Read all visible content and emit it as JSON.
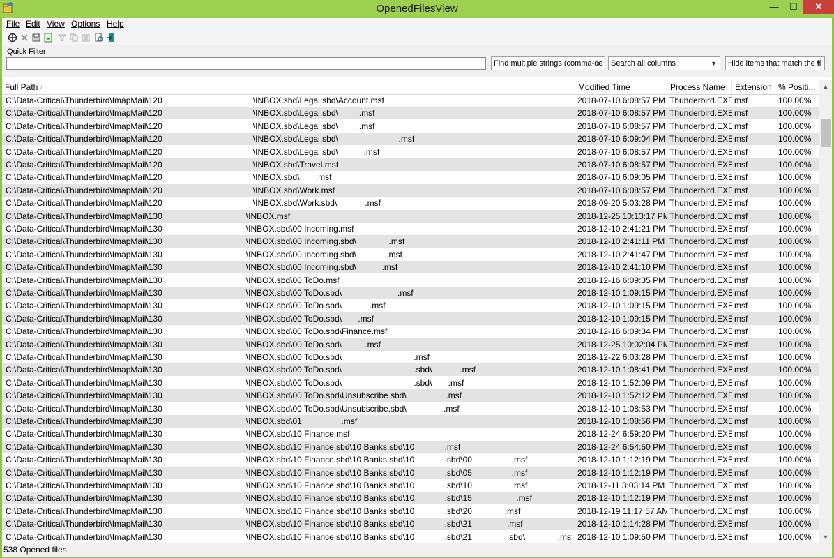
{
  "window": {
    "title": "OpenedFilesView",
    "min": "—",
    "max": "☐",
    "close": "✕"
  },
  "menu": [
    "File",
    "Edit",
    "View",
    "Options",
    "Help"
  ],
  "toolbar": {
    "icons": [
      "open-icon",
      "delete-icon",
      "save-icon",
      "refresh-icon",
      "filter-icon",
      "copy-icon",
      "properties-icon",
      "find-icon",
      "exit-icon"
    ]
  },
  "filter": {
    "label": "Quick Filter",
    "value": "",
    "mode": "Find multiple strings (comma-de",
    "columns": "Search all columns",
    "action": "Hide items that match the fi"
  },
  "columns": [
    "Full Path",
    "Modified Time",
    "Process Name",
    "Extension",
    "% Positi..."
  ],
  "rows": [
    {
      "path": "C:\\Data-Critical\\Thunderbird\\ImapMail\\120                                       \\INBOX.sbd\\Legal.sbd\\Account.msf",
      "modified": "2018-07-10 6:08:57 PM",
      "process": "Thunderbird.EXE",
      "ext": "msf",
      "pos": "100.00%"
    },
    {
      "path": "C:\\Data-Critical\\Thunderbird\\ImapMail\\120                                       \\INBOX.sbd\\Legal.sbd\\         .msf",
      "modified": "2018-07-10 6:08:57 PM",
      "process": "Thunderbird.EXE",
      "ext": "msf",
      "pos": "100.00%"
    },
    {
      "path": "C:\\Data-Critical\\Thunderbird\\ImapMail\\120                                       \\INBOX.sbd\\Legal.sbd\\         .msf",
      "modified": "2018-07-10 6:08:57 PM",
      "process": "Thunderbird.EXE",
      "ext": "msf",
      "pos": "100.00%"
    },
    {
      "path": "C:\\Data-Critical\\Thunderbird\\ImapMail\\120                                       \\INBOX.sbd\\Legal.sbd\\                          .msf",
      "modified": "2018-07-10 6:09:04 PM",
      "process": "Thunderbird.EXE",
      "ext": "msf",
      "pos": "100.00%"
    },
    {
      "path": "C:\\Data-Critical\\Thunderbird\\ImapMail\\120                                       \\INBOX.sbd\\Legal.sbd\\           .msf",
      "modified": "2018-07-10 6:08:57 PM",
      "process": "Thunderbird.EXE",
      "ext": "msf",
      "pos": "100.00%"
    },
    {
      "path": "C:\\Data-Critical\\Thunderbird\\ImapMail\\120                                       \\INBOX.sbd\\Travel.msf",
      "modified": "2018-07-10 6:08:57 PM",
      "process": "Thunderbird.EXE",
      "ext": "msf",
      "pos": "100.00%"
    },
    {
      "path": "C:\\Data-Critical\\Thunderbird\\ImapMail\\120                                       \\INBOX.sbd\\       .msf",
      "modified": "2018-07-10 6:09:05 PM",
      "process": "Thunderbird.EXE",
      "ext": "msf",
      "pos": "100.00%"
    },
    {
      "path": "C:\\Data-Critical\\Thunderbird\\ImapMail\\120                                       \\INBOX.sbd\\Work.msf",
      "modified": "2018-07-10 6:08:57 PM",
      "process": "Thunderbird.EXE",
      "ext": "msf",
      "pos": "100.00%"
    },
    {
      "path": "C:\\Data-Critical\\Thunderbird\\ImapMail\\120                                       \\INBOX.sbd\\Work.sbd\\            .msf",
      "modified": "2018-09-20 5:03:28 PM",
      "process": "Thunderbird.EXE",
      "ext": "msf",
      "pos": "100.00%"
    },
    {
      "path": "C:\\Data-Critical\\Thunderbird\\ImapMail\\130                                    \\INBOX.msf",
      "modified": "2018-12-25 10:13:17 PM",
      "process": "Thunderbird.EXE",
      "ext": "msf",
      "pos": "100.00%"
    },
    {
      "path": "C:\\Data-Critical\\Thunderbird\\ImapMail\\130                                    \\INBOX.sbd\\00 Incoming.msf",
      "modified": "2018-12-10 2:41:21 PM",
      "process": "Thunderbird.EXE",
      "ext": "msf",
      "pos": "100.00%"
    },
    {
      "path": "C:\\Data-Critical\\Thunderbird\\ImapMail\\130                                    \\INBOX.sbd\\00 Incoming.sbd\\              .msf",
      "modified": "2018-12-10 2:41:11 PM",
      "process": "Thunderbird.EXE",
      "ext": "msf",
      "pos": "100.00%"
    },
    {
      "path": "C:\\Data-Critical\\Thunderbird\\ImapMail\\130                                    \\INBOX.sbd\\00 Incoming.sbd\\             .msf",
      "modified": "2018-12-10 2:41:47 PM",
      "process": "Thunderbird.EXE",
      "ext": "msf",
      "pos": "100.00%"
    },
    {
      "path": "C:\\Data-Critical\\Thunderbird\\ImapMail\\130                                    \\INBOX.sbd\\00 Incoming.sbd\\           .msf",
      "modified": "2018-12-10 2:41:10 PM",
      "process": "Thunderbird.EXE",
      "ext": "msf",
      "pos": "100.00%"
    },
    {
      "path": "C:\\Data-Critical\\Thunderbird\\ImapMail\\130                                    \\INBOX.sbd\\00 ToDo.msf",
      "modified": "2018-12-16 6:09:35 PM",
      "process": "Thunderbird.EXE",
      "ext": "msf",
      "pos": "100.00%"
    },
    {
      "path": "C:\\Data-Critical\\Thunderbird\\ImapMail\\130                                    \\INBOX.sbd\\00 ToDo.sbd\\                        .msf",
      "modified": "2018-12-10 1:09:15 PM",
      "process": "Thunderbird.EXE",
      "ext": "msf",
      "pos": "100.00%"
    },
    {
      "path": "C:\\Data-Critical\\Thunderbird\\ImapMail\\130                                    \\INBOX.sbd\\00 ToDo.sbd\\            .msf",
      "modified": "2018-12-10 1:09:15 PM",
      "process": "Thunderbird.EXE",
      "ext": "msf",
      "pos": "100.00%"
    },
    {
      "path": "C:\\Data-Critical\\Thunderbird\\ImapMail\\130                                    \\INBOX.sbd\\00 ToDo.sbd\\       .msf",
      "modified": "2018-12-10 1:09:15 PM",
      "process": "Thunderbird.EXE",
      "ext": "msf",
      "pos": "100.00%"
    },
    {
      "path": "C:\\Data-Critical\\Thunderbird\\ImapMail\\130                                    \\INBOX.sbd\\00 ToDo.sbd\\Finance.msf",
      "modified": "2018-12-16 6:09:34 PM",
      "process": "Thunderbird.EXE",
      "ext": "msf",
      "pos": "100.00%"
    },
    {
      "path": "C:\\Data-Critical\\Thunderbird\\ImapMail\\130                                    \\INBOX.sbd\\00 ToDo.sbd\\          .msf",
      "modified": "2018-12-25 10:02:04 PM",
      "process": "Thunderbird.EXE",
      "ext": "msf",
      "pos": "100.00%"
    },
    {
      "path": "C:\\Data-Critical\\Thunderbird\\ImapMail\\130                                    \\INBOX.sbd\\00 ToDo.sbd\\                               .msf",
      "modified": "2018-12-22 6:03:28 PM",
      "process": "Thunderbird.EXE",
      "ext": "msf",
      "pos": "100.00%"
    },
    {
      "path": "C:\\Data-Critical\\Thunderbird\\ImapMail\\130                                    \\INBOX.sbd\\00 ToDo.sbd\\                               .sbd\\            .msf",
      "modified": "2018-12-10 1:08:41 PM",
      "process": "Thunderbird.EXE",
      "ext": "msf",
      "pos": "100.00%"
    },
    {
      "path": "C:\\Data-Critical\\Thunderbird\\ImapMail\\130                                    \\INBOX.sbd\\00 ToDo.sbd\\                               .sbd\\       .msf",
      "modified": "2018-12-10 1:52:09 PM",
      "process": "Thunderbird.EXE",
      "ext": "msf",
      "pos": "100.00%"
    },
    {
      "path": "C:\\Data-Critical\\Thunderbird\\ImapMail\\130                                    \\INBOX.sbd\\00 ToDo.sbd\\Unsubscribe.sbd\\                 .msf",
      "modified": "2018-12-10 1:52:12 PM",
      "process": "Thunderbird.EXE",
      "ext": "msf",
      "pos": "100.00%"
    },
    {
      "path": "C:\\Data-Critical\\Thunderbird\\ImapMail\\130                                    \\INBOX.sbd\\00 ToDo.sbd\\Unsubscribe.sbd\\                .msf",
      "modified": "2018-12-10 1:08:53 PM",
      "process": "Thunderbird.EXE",
      "ext": "msf",
      "pos": "100.00%"
    },
    {
      "path": "C:\\Data-Critical\\Thunderbird\\ImapMail\\130                                    \\INBOX.sbd\\01                 .msf",
      "modified": "2018-12-10 1:08:56 PM",
      "process": "Thunderbird.EXE",
      "ext": "msf",
      "pos": "100.00%"
    },
    {
      "path": "C:\\Data-Critical\\Thunderbird\\ImapMail\\130                                    \\INBOX.sbd\\10 Finance.msf",
      "modified": "2018-12-24 6:59:20 PM",
      "process": "Thunderbird.EXE",
      "ext": "msf",
      "pos": "100.00%"
    },
    {
      "path": "C:\\Data-Critical\\Thunderbird\\ImapMail\\130                                    \\INBOX.sbd\\10 Finance.sbd\\10 Banks.sbd\\10             .msf",
      "modified": "2018-12-24 6:54:50 PM",
      "process": "Thunderbird.EXE",
      "ext": "msf",
      "pos": "100.00%"
    },
    {
      "path": "C:\\Data-Critical\\Thunderbird\\ImapMail\\130                                    \\INBOX.sbd\\10 Finance.sbd\\10 Banks.sbd\\10             .sbd\\00                 .msf",
      "modified": "2018-12-10 1:12:19 PM",
      "process": "Thunderbird.EXE",
      "ext": "msf",
      "pos": "100.00%"
    },
    {
      "path": "C:\\Data-Critical\\Thunderbird\\ImapMail\\130                                    \\INBOX.sbd\\10 Finance.sbd\\10 Banks.sbd\\10             .sbd\\05                 .msf",
      "modified": "2018-12-10 1:12:19 PM",
      "process": "Thunderbird.EXE",
      "ext": "msf",
      "pos": "100.00%"
    },
    {
      "path": "C:\\Data-Critical\\Thunderbird\\ImapMail\\130                                    \\INBOX.sbd\\10 Finance.sbd\\10 Banks.sbd\\10             .sbd\\10                 .msf",
      "modified": "2018-12-11 3:03:14 PM",
      "process": "Thunderbird.EXE",
      "ext": "msf",
      "pos": "100.00%"
    },
    {
      "path": "C:\\Data-Critical\\Thunderbird\\ImapMail\\130                                    \\INBOX.sbd\\10 Finance.sbd\\10 Banks.sbd\\10             .sbd\\15                   .msf",
      "modified": "2018-12-10 1:12:19 PM",
      "process": "Thunderbird.EXE",
      "ext": "msf",
      "pos": "100.00%"
    },
    {
      "path": "C:\\Data-Critical\\Thunderbird\\ImapMail\\130                                    \\INBOX.sbd\\10 Finance.sbd\\10 Banks.sbd\\10             .sbd\\20              .msf",
      "modified": "2018-12-19 11:17:57 AM",
      "process": "Thunderbird.EXE",
      "ext": "msf",
      "pos": "100.00%"
    },
    {
      "path": "C:\\Data-Critical\\Thunderbird\\ImapMail\\130                                    \\INBOX.sbd\\10 Finance.sbd\\10 Banks.sbd\\10             .sbd\\21               .msf",
      "modified": "2018-12-10 1:14:28 PM",
      "process": "Thunderbird.EXE",
      "ext": "msf",
      "pos": "100.00%"
    },
    {
      "path": "C:\\Data-Critical\\Thunderbird\\ImapMail\\130                                    \\INBOX.sbd\\10 Finance.sbd\\10 Banks.sbd\\10             .sbd\\21               .sbd\\              .msf",
      "modified": "2018-12-10 1:09:50 PM",
      "process": "Thunderbird.EXE",
      "ext": "msf",
      "pos": "100.00%"
    }
  ],
  "status": "538 Opened files",
  "colors": {
    "frame": "#8cc63f",
    "row_alt": "#e3e3e3",
    "close": "#c7403a"
  }
}
